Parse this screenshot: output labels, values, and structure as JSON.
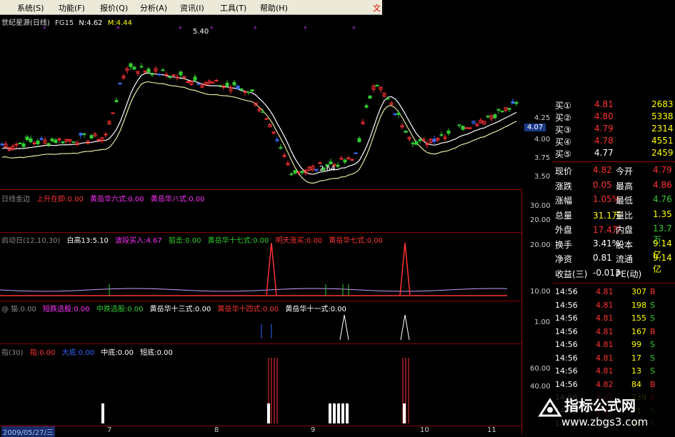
{
  "menu": {
    "items": [
      "系统(S)",
      "功能(F)",
      "报价(Q)",
      "分析(A)",
      "资讯(I)",
      "工具(T)",
      "帮助(H)"
    ],
    "brand": "文"
  },
  "chart_header": {
    "name": "世纪星源(日线)",
    "indicator": "FG15",
    "n_label": "N:4.62",
    "m_label": "M:4.44"
  },
  "price_annotations": {
    "high": "5.40",
    "low": "2.64"
  },
  "price_axis": [
    "4.25",
    "4.07",
    "4.00",
    "3.75",
    "3.50"
  ],
  "panel1": {
    "title": "日线金边",
    "items": [
      {
        "text": "上升在即:0.00",
        "color": "red"
      },
      {
        "text": "黄岳华六式:0.00",
        "color": "magenta"
      },
      {
        "text": "黄岳华八式:0.00",
        "color": "magenta"
      }
    ],
    "axis": [
      "30.00",
      "20.00"
    ]
  },
  "panel2": {
    "title": "启动日(12,10,30)",
    "items": [
      {
        "text": "白高13:5.10",
        "color": "white"
      },
      {
        "text": "波段买入:4.67",
        "color": "magenta"
      },
      {
        "text": "狙击:0.00",
        "color": "green"
      },
      {
        "text": "黄岳华十七式:0.00",
        "color": "green"
      },
      {
        "text": "明天涨买:0.00",
        "color": "red"
      },
      {
        "text": "黄岳华七式:0.00",
        "color": "red"
      }
    ],
    "axis": [
      "20.00",
      "10.00"
    ]
  },
  "panel3": {
    "title": "@ 猫:0.00",
    "items": [
      {
        "text": "短跌选股:0.00",
        "color": "magenta"
      },
      {
        "text": "中跌选股:0.00",
        "color": "green"
      },
      {
        "text": "黄岳华十三式:0.00",
        "color": "white"
      },
      {
        "text": "黄岳华十四式:0.00",
        "color": "red"
      },
      {
        "text": "黄岳华十一式:0.00",
        "color": "white"
      }
    ],
    "axis": [
      "1.00"
    ]
  },
  "panel4": {
    "title": "指(30)",
    "items": [
      {
        "text": "指:0.00",
        "color": "red"
      },
      {
        "text": "大底:0.00",
        "color": "blue"
      },
      {
        "text": "中底:0.00",
        "color": "white"
      },
      {
        "text": "短底:0.00",
        "color": "white"
      }
    ],
    "axis": [
      "60.00",
      "40.00"
    ]
  },
  "x_axis": {
    "date": "2009/05/27/三",
    "months": [
      "7",
      "8",
      "9",
      "10",
      "11"
    ]
  },
  "current_price_tag": "4.07",
  "quote": {
    "bids": [
      {
        "label": "买①",
        "price": "4.81",
        "vol": "2683"
      },
      {
        "label": "买②",
        "price": "4.80",
        "vol": "5338"
      },
      {
        "label": "买③",
        "price": "4.79",
        "vol": "2314"
      },
      {
        "label": "买④",
        "price": "4.78",
        "vol": "4551"
      },
      {
        "label": "买⑤",
        "price": "4.77",
        "vol": "2459"
      }
    ],
    "stats": [
      {
        "l1": "现价",
        "v1": "4.82",
        "l2": "今开",
        "v2": "4.79"
      },
      {
        "l1": "涨跌",
        "v1": "0.05",
        "l2": "最高",
        "v2": "4.86"
      },
      {
        "l1": "涨幅",
        "v1": "1.05%",
        "l2": "最低",
        "v2": "4.76"
      },
      {
        "l1": "总量",
        "v1": "31.1万",
        "l2": "量比",
        "v2": "1.35"
      },
      {
        "l1": "外盘",
        "v1": "17.4万",
        "l2": "内盘",
        "v2": "13.7万"
      },
      {
        "l1": "换手",
        "v1": "3.41%",
        "l2": "股本",
        "v2": "9.14亿"
      },
      {
        "l1": "净资",
        "v1": "0.81",
        "l2": "流通",
        "v2": "9.14亿"
      },
      {
        "l1": "收益(三)",
        "v1": "-0.013",
        "l2": "PE(动)",
        "v2": ""
      }
    ],
    "ticks": [
      {
        "t": "14:56",
        "p": "4.81",
        "v": "307",
        "s": "B"
      },
      {
        "t": "14:56",
        "p": "4.81",
        "v": "198",
        "s": "S"
      },
      {
        "t": "14:56",
        "p": "4.81",
        "v": "155",
        "s": "S"
      },
      {
        "t": "14:56",
        "p": "4.81",
        "v": "167",
        "s": "B"
      },
      {
        "t": "14:56",
        "p": "4.81",
        "v": "99",
        "s": "S"
      },
      {
        "t": "14:56",
        "p": "4.81",
        "v": "17",
        "s": "S"
      },
      {
        "t": "14:56",
        "p": "4.81",
        "v": "13",
        "s": "S"
      },
      {
        "t": "14:56",
        "p": "4.82",
        "v": "84",
        "s": "B"
      },
      {
        "t": "14:56",
        "p": "4.82",
        "v": "239",
        "s": "B"
      },
      {
        "t": "14:56",
        "p": "4.82",
        "v": "71",
        "s": "S"
      },
      {
        "t": "14:56",
        "p": "4.82",
        "v": "24",
        "s": "S"
      }
    ]
  },
  "watermark": {
    "title": "指标公式网",
    "url": "www.zbgs3.com"
  }
}
